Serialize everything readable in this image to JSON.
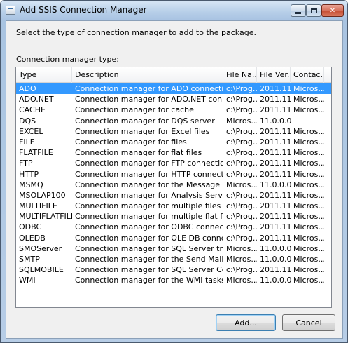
{
  "window": {
    "title": "Add SSIS Connection Manager"
  },
  "dialog": {
    "instruction": "Select the type of connection manager to add to the package.",
    "list_label": "Connection manager type:"
  },
  "columns": [
    "Type",
    "Description",
    "File Na...",
    "File Ver...",
    "Contac..."
  ],
  "rows": [
    {
      "type": "ADO",
      "description": "Connection manager for ADO connections",
      "file": "c:\\Prog...",
      "version": "2011.11....",
      "contact": "Micros..."
    },
    {
      "type": "ADO.NET",
      "description": "Connection manager for ADO.NET connections",
      "file": "c:\\Prog...",
      "version": "2011.11....",
      "contact": "Micros..."
    },
    {
      "type": "CACHE",
      "description": "Connection manager for cache",
      "file": "c:\\Prog...",
      "version": "2011.11....",
      "contact": "Micros..."
    },
    {
      "type": "DQS",
      "description": "Connection manager for DQS server",
      "file": "Micros...",
      "version": "11.0.0.0",
      "contact": ""
    },
    {
      "type": "EXCEL",
      "description": "Connection manager for Excel files",
      "file": "c:\\Prog...",
      "version": "2011.11....",
      "contact": "Micros..."
    },
    {
      "type": "FILE",
      "description": "Connection manager for files",
      "file": "c:\\Prog...",
      "version": "2011.11....",
      "contact": "Micros..."
    },
    {
      "type": "FLATFILE",
      "description": "Connection manager for flat files",
      "file": "c:\\Prog...",
      "version": "2011.11....",
      "contact": "Micros..."
    },
    {
      "type": "FTP",
      "description": "Connection manager for FTP connections",
      "file": "c:\\Prog...",
      "version": "2011.11....",
      "contact": "Micros..."
    },
    {
      "type": "HTTP",
      "description": "Connection manager for HTTP connections",
      "file": "c:\\Prog...",
      "version": "2011.11....",
      "contact": "Micros..."
    },
    {
      "type": "MSMQ",
      "description": "Connection manager for the Message Queue t...",
      "file": "Micros...",
      "version": "11.0.0.0",
      "contact": "Micros..."
    },
    {
      "type": "MSOLAP100",
      "description": "Connection manager for Analysis Services con...",
      "file": "c:\\Prog...",
      "version": "2011.11....",
      "contact": "Micros..."
    },
    {
      "type": "MULTIFILE",
      "description": "Connection manager for multiple files",
      "file": "c:\\Prog...",
      "version": "2011.11....",
      "contact": "Micros..."
    },
    {
      "type": "MULTIFLATFILE",
      "description": "Connection manager for multiple flat files",
      "file": "c:\\Prog...",
      "version": "2011.11....",
      "contact": "Micros..."
    },
    {
      "type": "ODBC",
      "description": "Connection manager for ODBC connections",
      "file": "c:\\Prog...",
      "version": "2011.11....",
      "contact": "Micros..."
    },
    {
      "type": "OLEDB",
      "description": "Connection manager for OLE DB connections",
      "file": "c:\\Prog...",
      "version": "2011.11....",
      "contact": "Micros..."
    },
    {
      "type": "SMOServer",
      "description": "Connection manager for SQL Server transfer ta...",
      "file": "Micros...",
      "version": "11.0.0.0",
      "contact": "Micros..."
    },
    {
      "type": "SMTP",
      "description": "Connection manager for the Send Mail task",
      "file": "Micros...",
      "version": "11.0.0.0",
      "contact": "Micros..."
    },
    {
      "type": "SQLMOBILE",
      "description": "Connection manager for SQL Server Compact ...",
      "file": "c:\\Prog...",
      "version": "2011.11....",
      "contact": "Micros..."
    },
    {
      "type": "WMI",
      "description": "Connection manager for the WMI tasks",
      "file": "Micros...",
      "version": "11.0.0.0",
      "contact": "Micros..."
    }
  ],
  "selected_row": "ADO",
  "buttons": {
    "add": "Add...",
    "cancel": "Cancel"
  },
  "colors": {
    "selection": "#3399ff",
    "window_frame": "#a9c4e1"
  }
}
